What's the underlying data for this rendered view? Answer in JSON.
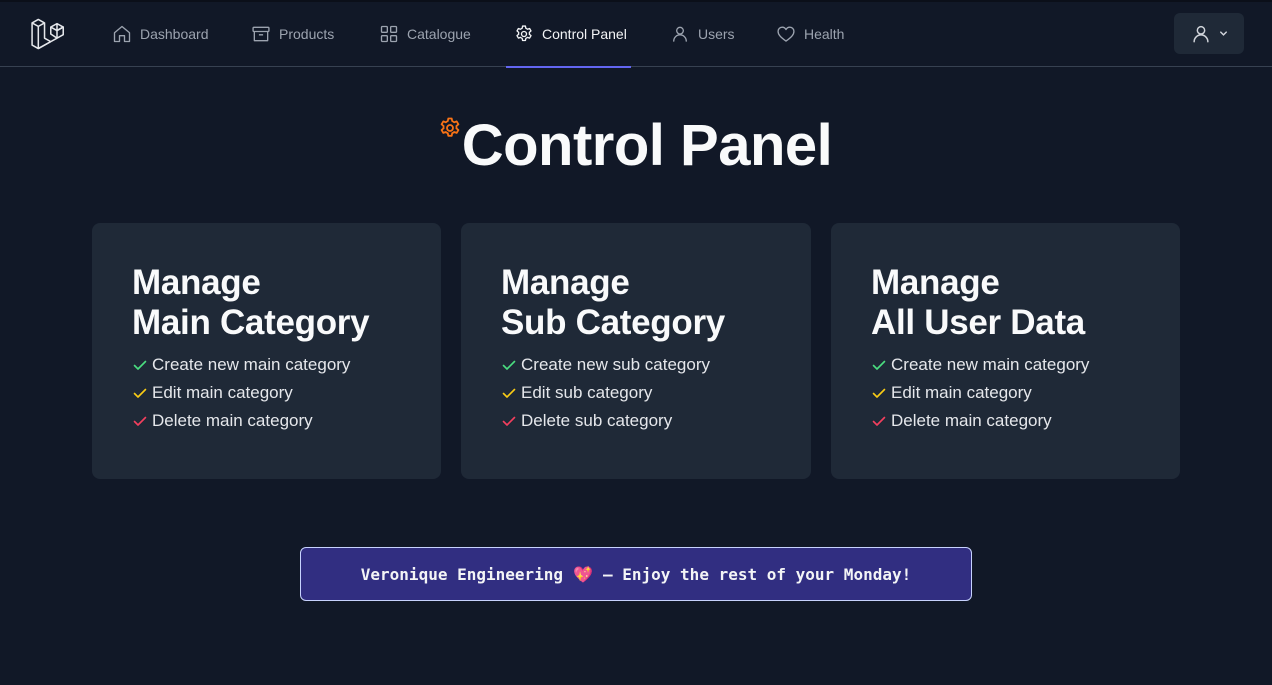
{
  "nav": {
    "items": [
      {
        "label": "Dashboard",
        "icon": "home-icon"
      },
      {
        "label": "Products",
        "icon": "archive-box-icon"
      },
      {
        "label": "Catalogue",
        "icon": "grid-icon"
      },
      {
        "label": "Control Panel",
        "icon": "gear-icon",
        "active": true
      },
      {
        "label": "Users",
        "icon": "user-icon"
      },
      {
        "label": "Health",
        "icon": "heart-icon"
      }
    ],
    "active_color": "#6366f1"
  },
  "page": {
    "title": "Control Panel",
    "title_icon_color": "#f97316"
  },
  "cards": [
    {
      "title_line1": "Manage",
      "title_line2": "Main Category",
      "features": [
        "Create new main category",
        "Edit main category",
        "Delete main category"
      ]
    },
    {
      "title_line1": "Manage",
      "title_line2": "Sub Category",
      "features": [
        "Create new sub category",
        "Edit sub category",
        "Delete sub category"
      ]
    },
    {
      "title_line1": "Manage",
      "title_line2": "All User Data",
      "features": [
        "Create new main category",
        "Edit main category",
        "Delete main category"
      ]
    }
  ],
  "check_colors": [
    "#4ade80",
    "#facc15",
    "#f43f5e"
  ],
  "banner": {
    "text_before": "Veronique Engineering",
    "emoji": "💖",
    "text_after": "— Enjoy the rest of your Monday!"
  }
}
